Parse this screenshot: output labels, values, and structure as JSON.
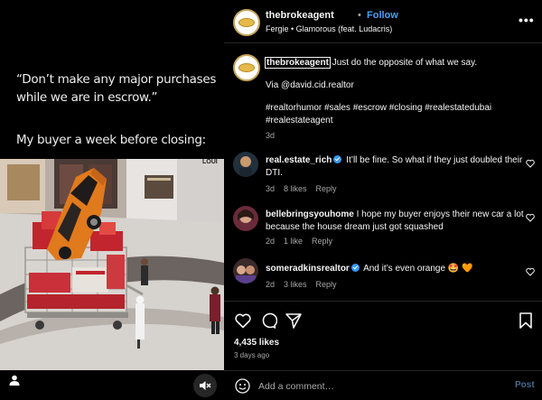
{
  "media": {
    "caption_quote": "“Don’t make any major purchases while we are in escrow.”",
    "caption_buyer": "My buyer a week before closing:",
    "store_sign": "LOUI",
    "mute_icon": "speaker-muted-icon",
    "tag_icon": "person-tag-icon"
  },
  "header": {
    "username": "thebrokeagent",
    "dot": "•",
    "follow_label": "Follow",
    "audio": "Fergie • Glamorous (feat. Ludacris)",
    "more": "•••"
  },
  "caption": {
    "username": "thebrokeagent",
    "line1": "Just do the opposite of what we say.",
    "line2": "Via @david.cid.realtor",
    "line3": "#realtorhumor #sales #escrow #closing #realestatedubai",
    "line4": "#realestateagent",
    "age": "3d"
  },
  "comments": [
    {
      "username": "real.estate_rich",
      "text": "It’ll be fine. So what if they just doubled their DTI.",
      "age": "3d",
      "likes": "8 likes",
      "reply": "Reply"
    },
    {
      "username": "bellebringsyouhome",
      "text": "I hope my buyer enjoys their new car a lot because the house dream just got squashed",
      "age": "2d",
      "likes": "1 like",
      "reply": "Reply"
    },
    {
      "username": "someradkinsrealtor",
      "text": "And it’s even orange 🤩 🧡",
      "age": "2d",
      "likes": "3 likes",
      "reply": "Reply"
    }
  ],
  "stats": {
    "likes": "4,435 likes",
    "ago": "3 days ago"
  },
  "add_comment": {
    "placeholder": "Add a comment…",
    "post_label": "Post"
  },
  "colors": {
    "accent": "#4a9ff5",
    "verified": "#3897f0",
    "muted": "#a8a8a8",
    "car": "#e07a1c",
    "gift_red": "#c2252d"
  }
}
